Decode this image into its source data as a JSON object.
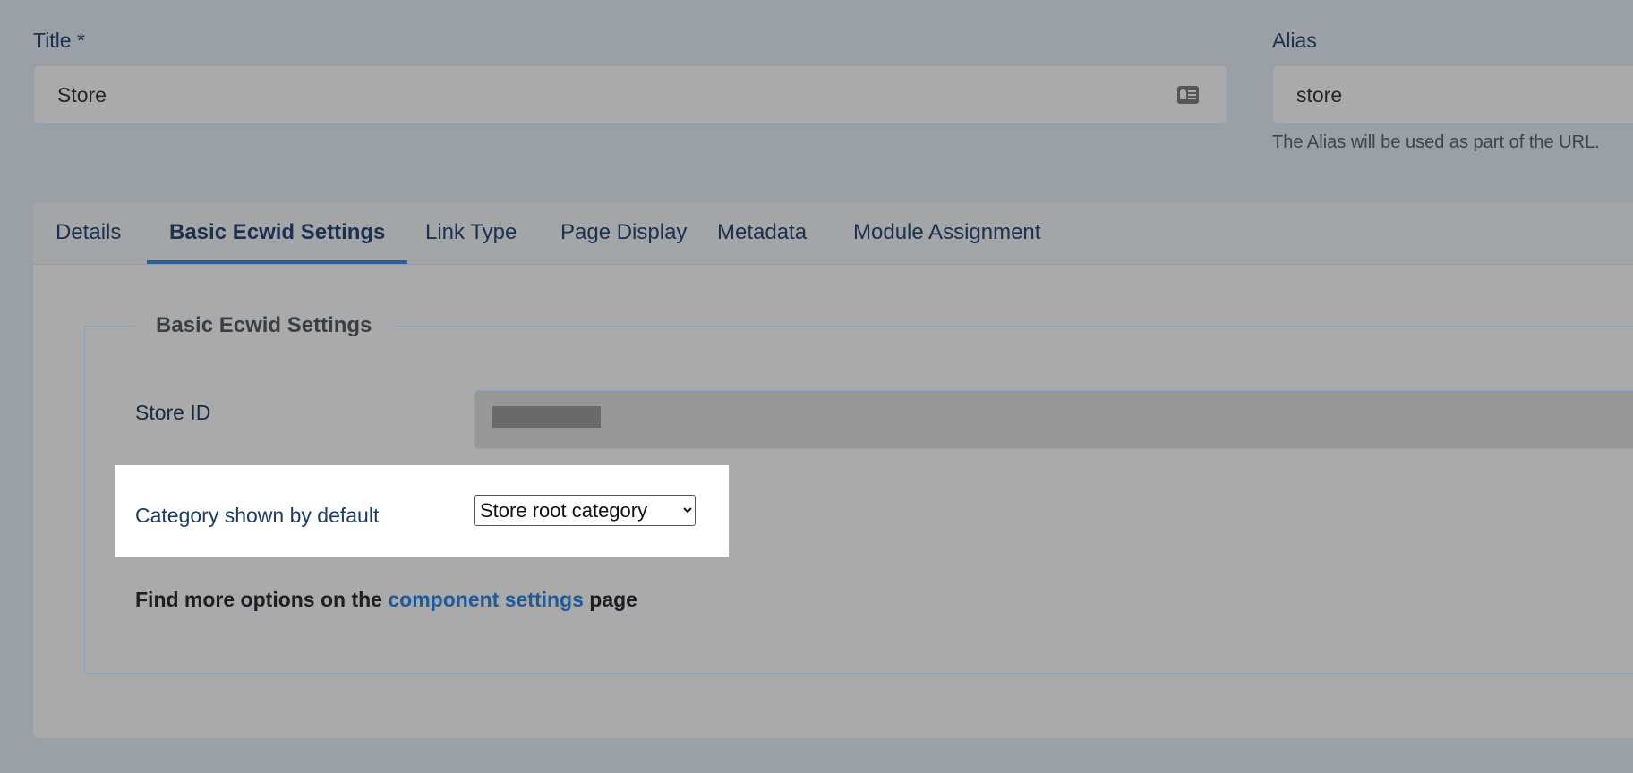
{
  "form": {
    "title_label": "Title *",
    "title_value": "Store",
    "alias_label": "Alias",
    "alias_value": "store",
    "alias_help": "The Alias will be used as part of the URL."
  },
  "tabs": [
    {
      "label": "Details"
    },
    {
      "label": "Basic Ecwid Settings",
      "active": true
    },
    {
      "label": "Link Type"
    },
    {
      "label": "Page Display"
    },
    {
      "label": "Metadata"
    },
    {
      "label": "Module Assignment"
    }
  ],
  "settings": {
    "legend": "Basic Ecwid Settings",
    "store_id_label": "Store ID",
    "category_label": "Category shown by default",
    "category_selected": "Store root category",
    "find_more_prefix": "Find more options on the",
    "find_more_link": "component settings",
    "find_more_suffix": "page"
  },
  "icons": {
    "title_input_icon": "id-card-icon"
  },
  "colors": {
    "link": "#1f5a99",
    "active_tab_underline": "#2c5f97"
  }
}
